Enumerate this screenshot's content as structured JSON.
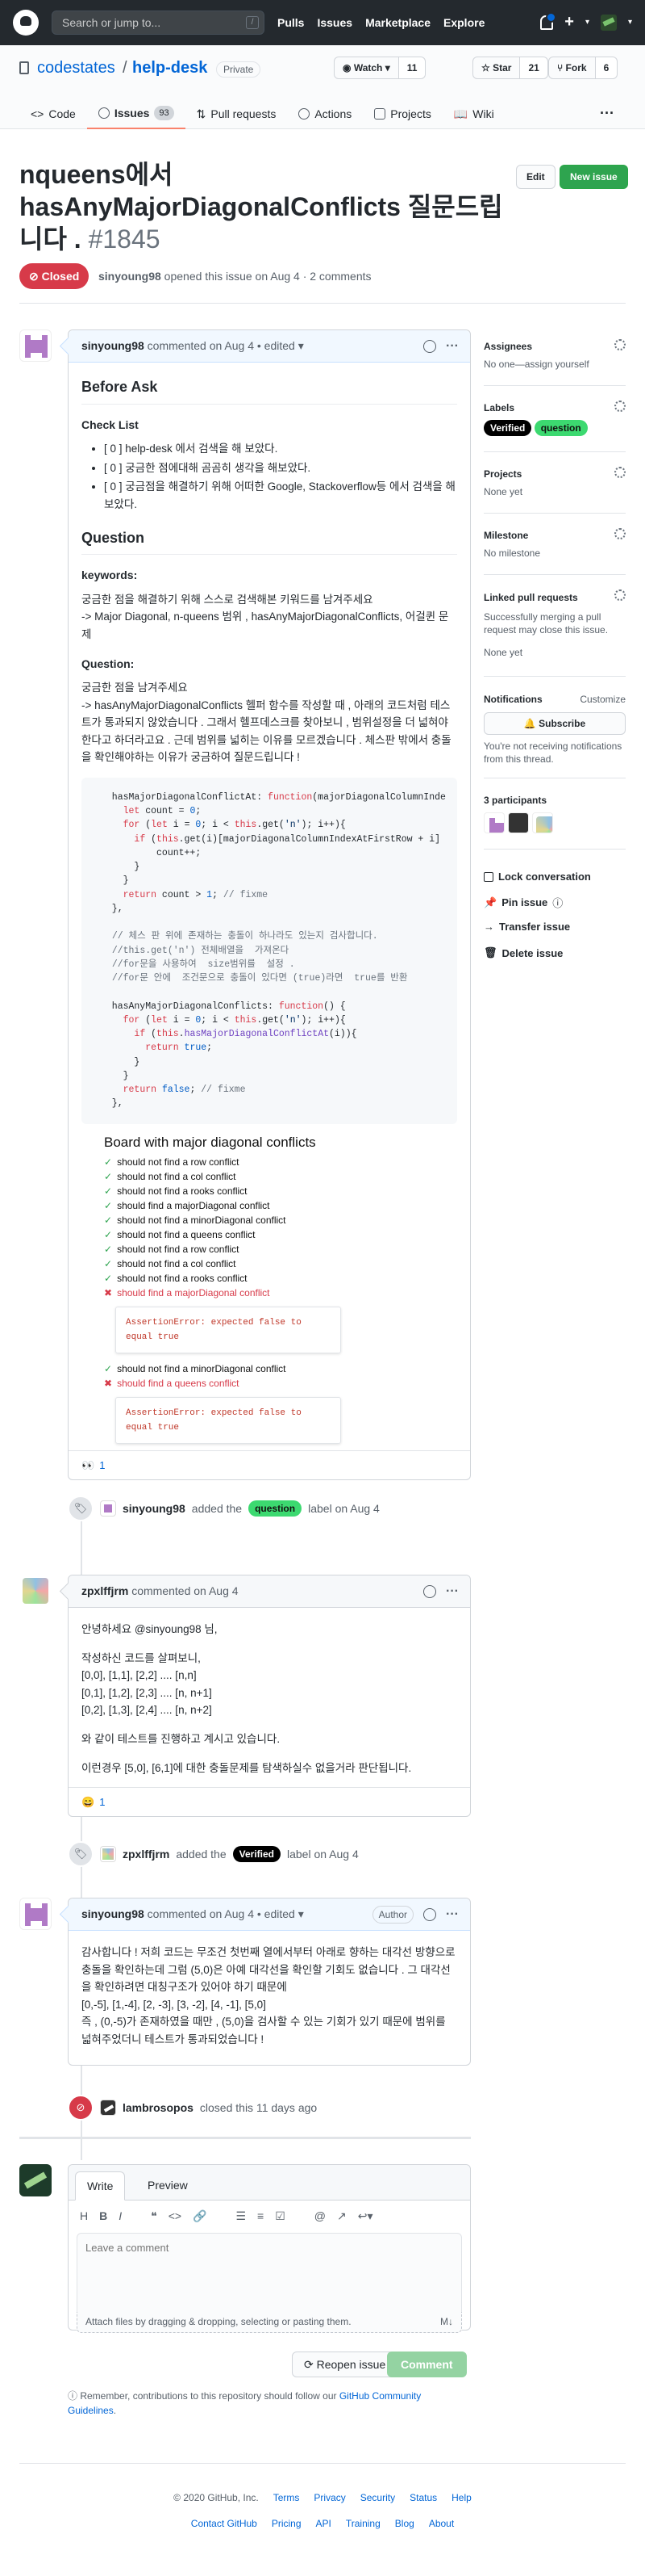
{
  "header": {
    "search_placeholder": "Search or jump to...",
    "slash": "/",
    "nav": [
      "Pulls",
      "Issues",
      "Marketplace",
      "Explore"
    ]
  },
  "repo": {
    "owner": "codestates",
    "slash": "/",
    "name": "help-desk",
    "visibility": "Private",
    "watch": {
      "label": "Watch",
      "count": "11"
    },
    "star": {
      "label": "Star",
      "count": "21"
    },
    "fork": {
      "label": "Fork",
      "count": "6"
    }
  },
  "tabs": [
    {
      "label": "Code"
    },
    {
      "label": "Issues",
      "count": "93"
    },
    {
      "label": "Pull requests"
    },
    {
      "label": "Actions"
    },
    {
      "label": "Projects"
    },
    {
      "label": "Wiki"
    }
  ],
  "issue": {
    "title": "nqueens에서 hasAnyMajorDiagonalConflicts  질문드립니다 . ",
    "number": "#1845",
    "edit_label": "Edit",
    "new_label": "New issue",
    "state": "Closed",
    "author": "sinyoung98",
    "meta": " opened this issue on Aug 4 · 2 comments"
  },
  "comment1": {
    "author": "sinyoung98",
    "meta": " commented on Aug 4 • edited ▾",
    "h_before": "Before Ask",
    "h_check": "Check List",
    "checks": [
      "[ 0 ] help-desk 에서 검색을 해 보았다.",
      "[ 0 ] 궁금한 점에대해 곰곰히 생각을 해보았다.",
      "[ 0 ] 궁금점을 해결하기 위해 어떠한 Google, Stackoverflow등 에서 검색을 해 보았다."
    ],
    "h_question": "Question",
    "h_keywords": "keywords:",
    "kw_line1": "궁금한 점을 해결하기 위해 스스로 검색해본 키워드를 남겨주세요",
    "kw_line2": "-> Major Diagonal, n-queens 범위 ,    hasAnyMajorDiagonalConflicts,    어걸퀸  문제",
    "h_q2": "Question:",
    "q_line1": "궁금한 점을 남겨주세요",
    "q_line2": "-> hasAnyMajorDiagonalConflicts 헬퍼  함수를  작성할  때 , 아래의  코드처럼  테스트가  통과되지  않았습니다 .   그래서  헬프데스크를 찾아보니 , 범위설정을 더 넓혀야  한다고  하더라고요 .   근데  범위를 넓히는  이유를  모르겠습니다 .   체스판  밖에서  충돌을  확인해야하는  이유가  궁금하여  질문드립니다 !",
    "shot_title": "Board with major diagonal conflicts",
    "shot_items": [
      {
        "t": "should not find a row conflict",
        "ok": true
      },
      {
        "t": "should not find a col conflict",
        "ok": true
      },
      {
        "t": "should not find a rooks conflict",
        "ok": true
      },
      {
        "t": "should find a majorDiagonal conflict",
        "ok": true
      },
      {
        "t": "should not find a minorDiagonal conflict",
        "ok": true
      },
      {
        "t": "should not find a queens conflict",
        "ok": true
      },
      {
        "t": "should not find a row conflict",
        "ok": true
      },
      {
        "t": "should not find a col conflict",
        "ok": true
      },
      {
        "t": "should not find a rooks conflict",
        "ok": true
      },
      {
        "t": "should find a majorDiagonal conflict",
        "ok": false,
        "err": "AssertionError: expected false to equal true"
      },
      {
        "t": "should not find a minorDiagonal conflict",
        "ok": true
      },
      {
        "t": "should find a queens conflict",
        "ok": false,
        "err": "AssertionError: expected false to equal true"
      }
    ],
    "reaction": {
      "emoji": "👀",
      "count": "1"
    }
  },
  "event1": {
    "author": "sinyoung98",
    "pre": " added the ",
    "label": "question",
    "post": " label on Aug 4"
  },
  "comment2": {
    "author": "zpxlffjrm",
    "meta": " commented on Aug 4",
    "lines": [
      "안녕하세요 @sinyoung98 님,",
      "작성하신 코드를 살펴보니,",
      "[0,0], [1,1], [2,2] .... [n,n]",
      "[0,1], [1,2], [2,3] .... [n, n+1]",
      "[0,2], [1,3], [2,4] .... [n, n+2]",
      "와 같이 테스트를 진행하고 계시고 있습니다.",
      "이런경우 [5,0], [6,1]에 대한 충돌문제를 탐색하실수 없을거라 판단됩니다."
    ],
    "reaction": {
      "emoji": "😄",
      "count": "1"
    }
  },
  "event2": {
    "author": "zpxlffjrm",
    "pre": " added the ",
    "label": "Verified",
    "post": " label on Aug 4"
  },
  "comment3": {
    "author": "sinyoung98",
    "meta": " commented on Aug 4 • edited ▾",
    "author_tag": "Author",
    "lines": [
      "감사합니다 ! 저희  코드는  무조건  첫번째  열에서부터  아래로  향하는  대각선  방향으로  충돌을  확인하는데  그럼  (5,0)은  아예  대각선을  확인할 기회도  없습니다 . 그  대각선을  확인하려면  대칭구조가  있어야  하기  때문에",
      "  [0,-5], [1,-4], [2, -3], [3, -2], [4, -1], [5,0]",
      "즉 ,   (0,-5)가  존재하였을  때만 ,   (5,0)을  검사할  수  있는  기회가  있기  때문에   범위를  넓혀주었더니  테스트가 통과되었습니다 !"
    ]
  },
  "event3": {
    "author": "lambrosopos",
    "post": " closed this 11 days ago"
  },
  "composer": {
    "write": "Write",
    "preview": "Preview",
    "placeholder": "Leave a comment",
    "attach": "Attach files by dragging & dropping, selecting or pasting them.",
    "reopen": "Reopen issue",
    "comment": "Comment",
    "remember_pre": "Remember, contributions to this repository should follow our ",
    "remember_link": "GitHub Community Guidelines",
    "remember_post": "."
  },
  "sidebar": {
    "assignees": {
      "h": "Assignees",
      "v": "No one—assign yourself"
    },
    "labels": {
      "h": "Labels",
      "items": [
        "Verified",
        "question"
      ]
    },
    "projects": {
      "h": "Projects",
      "v": "None yet"
    },
    "milestone": {
      "h": "Milestone",
      "v": "No milestone"
    },
    "linked": {
      "h": "Linked pull requests",
      "v": "Successfully merging a pull request may close this issue.",
      "v2": "None yet"
    },
    "notifications": {
      "h": "Notifications",
      "customize": "Customize",
      "btn": "Subscribe",
      "v": "You're not receiving notifications from this thread."
    },
    "participants": {
      "h": "3 participants"
    },
    "actions": [
      "Lock conversation",
      "Pin issue",
      "Transfer issue",
      "Delete issue"
    ]
  },
  "footer": {
    "copy": "© 2020 GitHub, Inc.",
    "row1": [
      "Terms",
      "Privacy",
      "Security",
      "Status",
      "Help"
    ],
    "row2": [
      "Contact GitHub",
      "Pricing",
      "API",
      "Training",
      "Blog",
      "About"
    ]
  },
  "colors": {
    "closed": "#d73a49",
    "primary": "#2ea44f",
    "label_question": "#3cd970",
    "label_verified": "#000000"
  }
}
